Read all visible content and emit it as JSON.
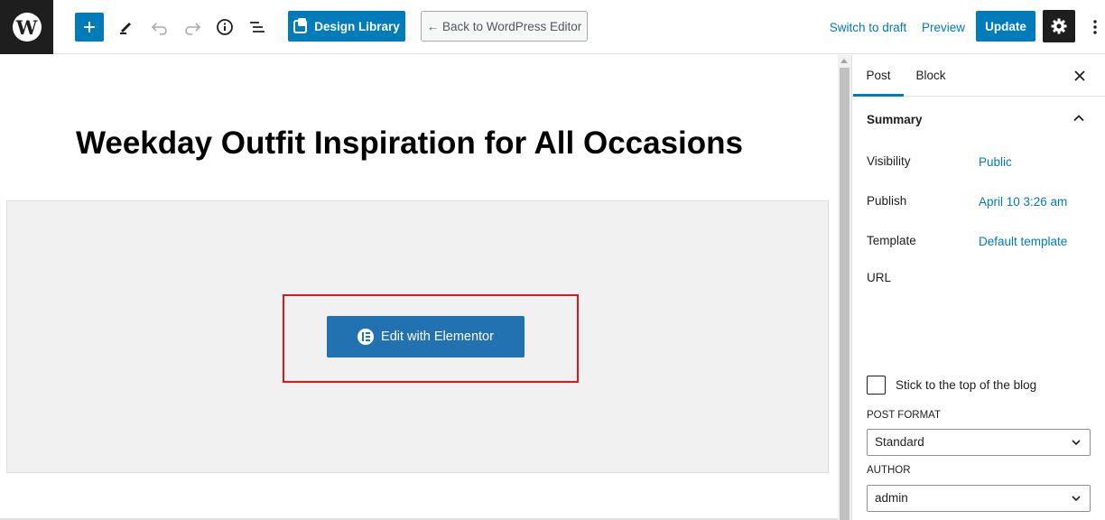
{
  "toolbar": {
    "wp_logo": "W",
    "design_library_label": "Design Library",
    "back_label": "← Back to WordPress Editor",
    "switch_draft_label": "Switch to draft",
    "preview_label": "Preview",
    "update_label": "Update",
    "icons": [
      "plus-icon",
      "pencil-icon",
      "undo-icon",
      "redo-icon",
      "info-icon",
      "list-view-icon",
      "gear-icon",
      "more-vertical-icon"
    ]
  },
  "editor": {
    "post_title": "Weekday Outfit Inspiration for All Occasions",
    "elementor_button_label": "Edit with Elementor"
  },
  "sidebar": {
    "tabs": [
      {
        "label": "Post",
        "active": true
      },
      {
        "label": "Block",
        "active": false
      }
    ],
    "summary": {
      "title": "Summary",
      "rows": [
        {
          "label": "Visibility",
          "value": "Public"
        },
        {
          "label": "Publish",
          "value": "April 10 3:26 am"
        },
        {
          "label": "Template",
          "value": "Default template"
        },
        {
          "label": "URL",
          "value": ""
        }
      ]
    },
    "stick_to_top_label": "Stick to the top of the blog",
    "stick_to_top_checked": false,
    "post_format": {
      "label": "POST FORMAT",
      "value": "Standard"
    },
    "author": {
      "label": "AUTHOR",
      "value": "admin"
    }
  },
  "colors": {
    "accent": "#007cba",
    "highlight": "#e0161d",
    "elementor_button": "#2271b1",
    "dark": "#1e1e1e"
  }
}
